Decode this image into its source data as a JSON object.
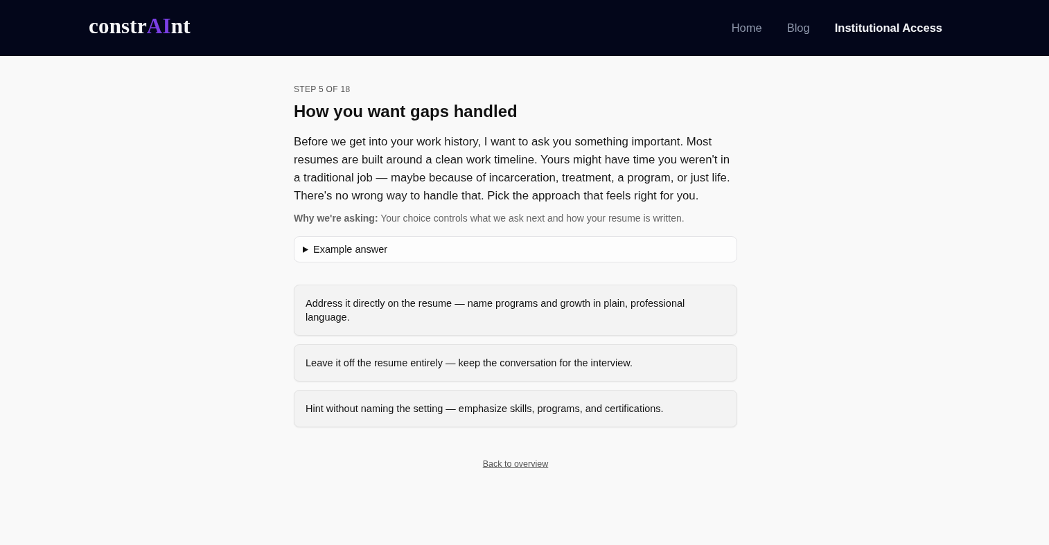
{
  "header": {
    "logo": [
      {
        "text": "constr",
        "color": "#f5f5f7"
      },
      {
        "text": "AI",
        "color": "#7b3fe4"
      },
      {
        "text": "nt",
        "color": "#f5f5f7"
      }
    ],
    "nav": [
      {
        "label": "Home",
        "selected": false
      },
      {
        "label": "Blog",
        "selected": false
      },
      {
        "label": "Institutional Access",
        "selected": true
      }
    ]
  },
  "step": {
    "label": "STEP 5 OF 18",
    "title": "How you want gaps handled",
    "intro": "Before we get into your work history, I want to ask you something important. Most resumes are built around a clean work timeline. Yours might have time you weren't in a traditional job — maybe because of incarceration, treatment, a program, or just life. There's no wrong way to handle that. Pick the approach that feels right for you.",
    "why": "**Why we're asking:** Your choice controls what we ask next and how your resume is written."
  },
  "example": {
    "summary": "Example answer",
    "expanded": false
  },
  "options": [
    {
      "text": "Address it directly on the resume — name programs and growth in plain, professional language.",
      "selected": false
    },
    {
      "text": "Leave it off the resume entirely — keep the conversation for the interview.",
      "selected": false
    },
    {
      "text": "Hint without naming the setting — emphasize skills, programs, and certifications.",
      "selected": false
    }
  ],
  "back_link": "Back to overview"
}
